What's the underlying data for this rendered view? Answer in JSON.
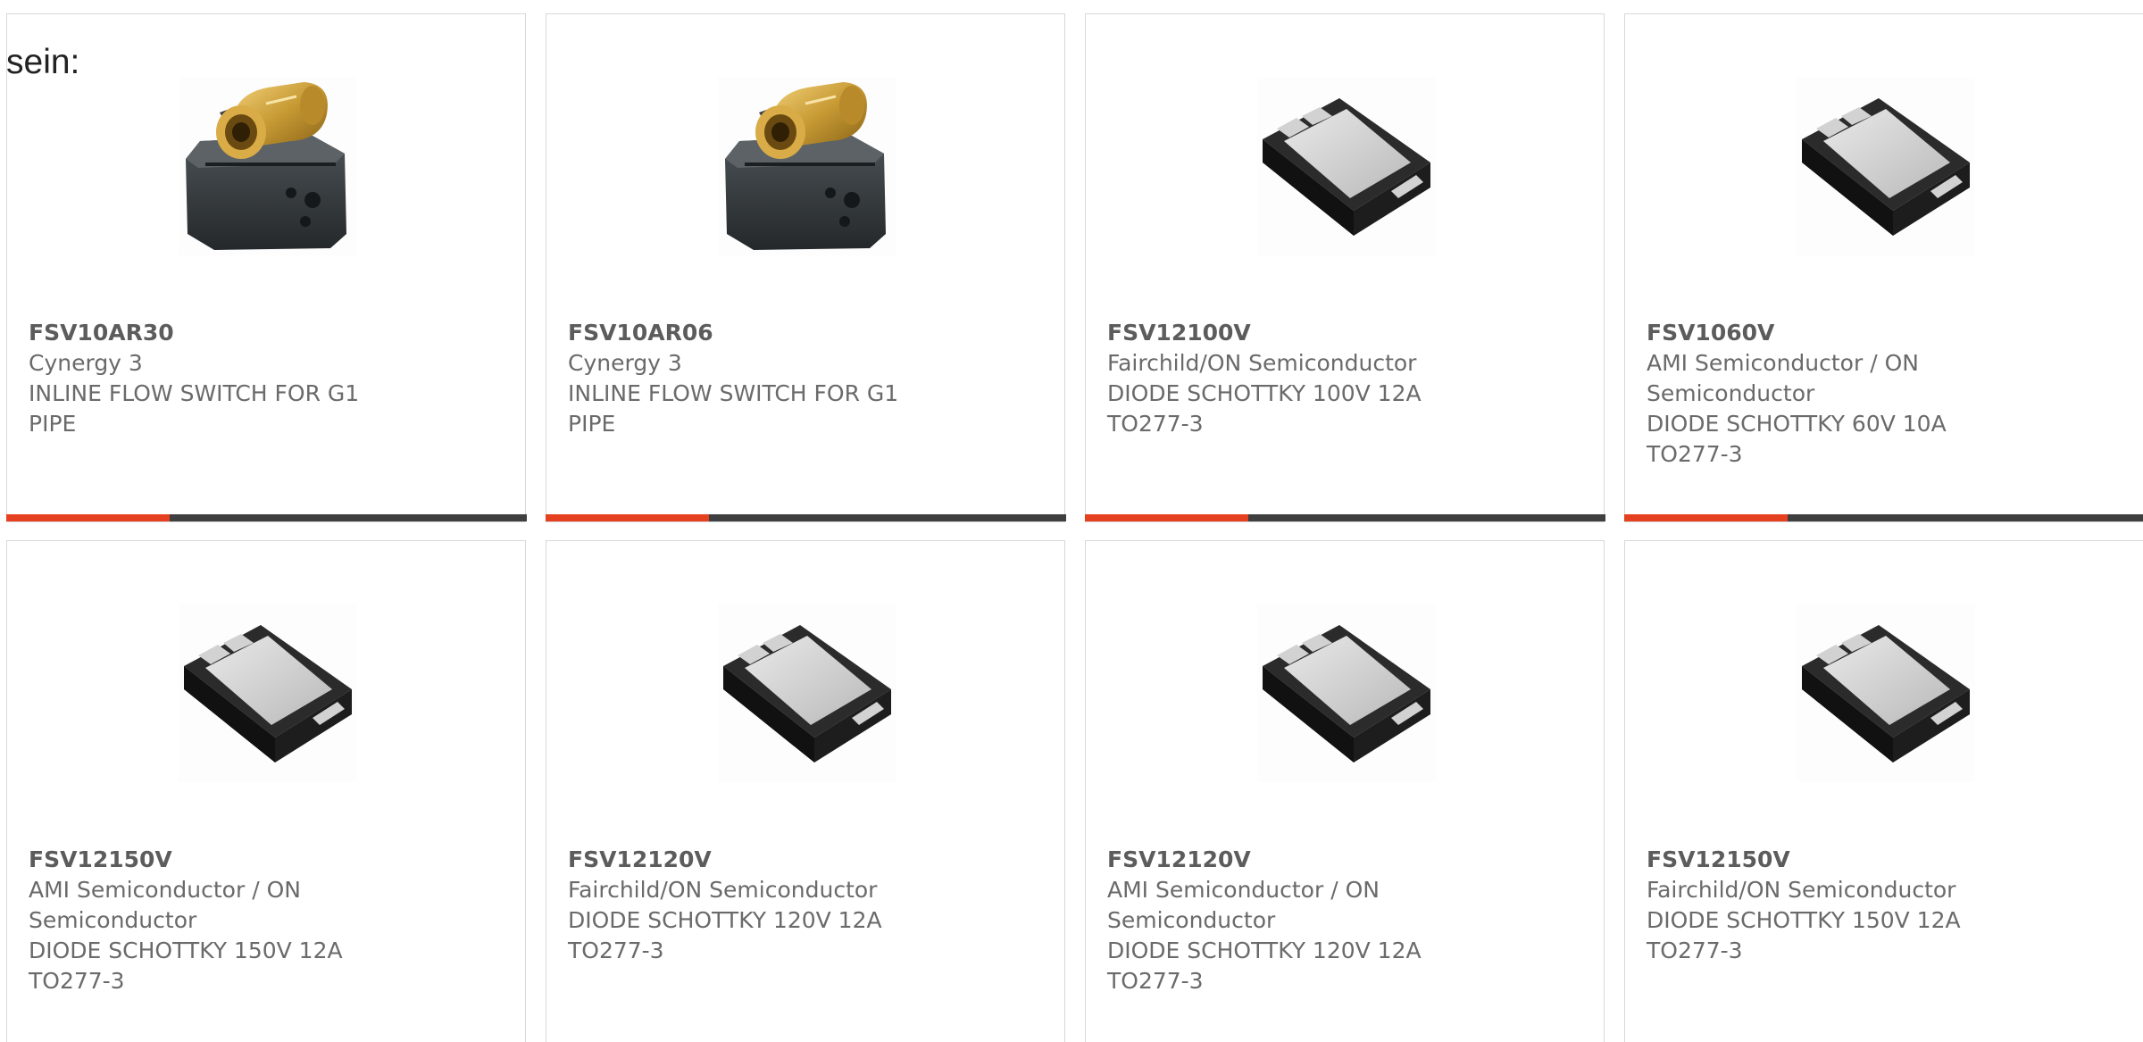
{
  "intro_text": "sein:",
  "colors": {
    "accent": "#e5401f",
    "bar": "#3f3f3f",
    "border": "#d8d8d8",
    "text": "#6a6a6a"
  },
  "products": [
    {
      "part": "FSV10AR30",
      "manufacturer": "Cynergy 3",
      "description": "INLINE FLOW SWITCH FOR G1 PIPE",
      "image": "flow-switch-icon"
    },
    {
      "part": "FSV10AR06",
      "manufacturer": "Cynergy 3",
      "description": "INLINE FLOW SWITCH FOR G1 PIPE",
      "image": "flow-switch-icon"
    },
    {
      "part": "FSV12100V",
      "manufacturer": "Fairchild/ON Semiconductor",
      "description": "DIODE SCHOTTKY 100V 12A TO277-3",
      "image": "diode-package-icon"
    },
    {
      "part": "FSV1060V",
      "manufacturer": "AMI Semiconductor / ON Semiconductor",
      "description": "DIODE SCHOTTKY 60V 10A TO277-3",
      "image": "diode-package-icon"
    },
    {
      "part": "FSV12150V",
      "manufacturer": "AMI Semiconductor / ON Semiconductor",
      "description": "DIODE SCHOTTKY 150V 12A TO277-3",
      "image": "diode-package-icon"
    },
    {
      "part": "FSV12120V",
      "manufacturer": "Fairchild/ON Semiconductor",
      "description": "DIODE SCHOTTKY 120V 12A TO277-3",
      "image": "diode-package-icon"
    },
    {
      "part": "FSV12120V",
      "manufacturer": "AMI Semiconductor / ON Semiconductor",
      "description": "DIODE SCHOTTKY 120V 12A TO277-3",
      "image": "diode-package-icon"
    },
    {
      "part": "FSV12150V",
      "manufacturer": "Fairchild/ON Semiconductor",
      "description": "DIODE SCHOTTKY 150V 12A TO277-3",
      "image": "diode-package-icon"
    }
  ]
}
